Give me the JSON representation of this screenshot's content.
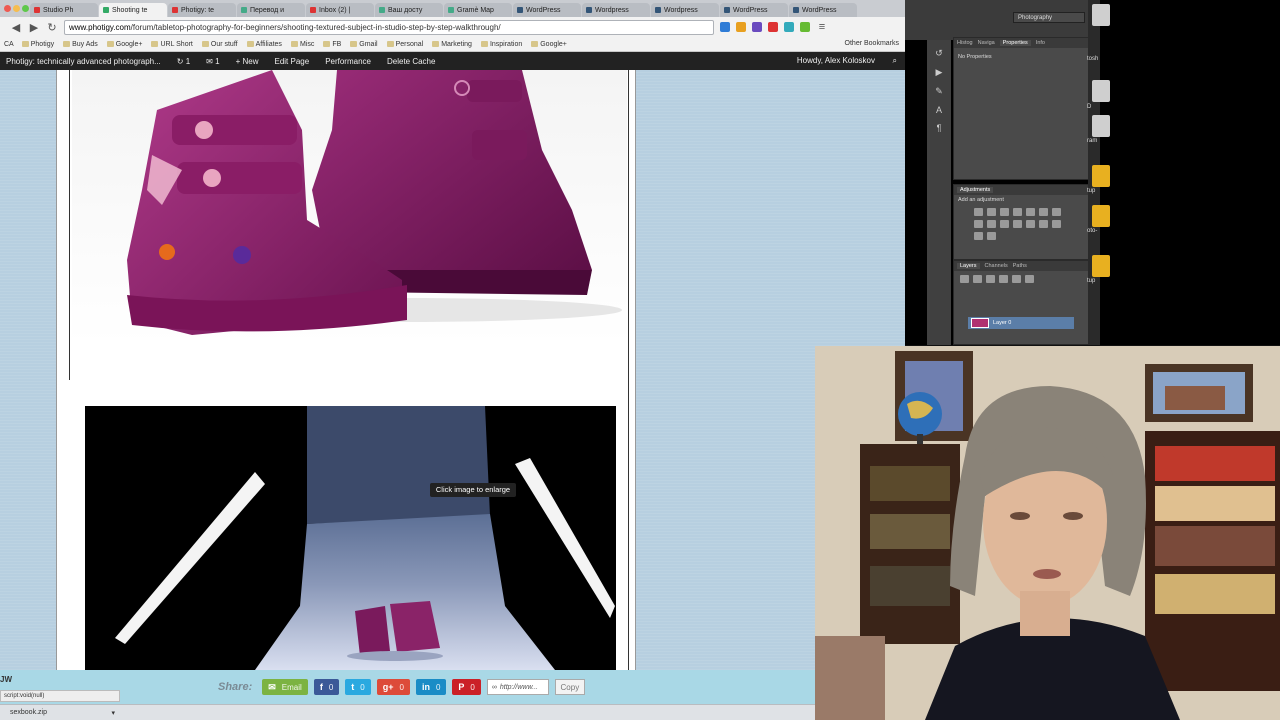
{
  "browser": {
    "tabs": [
      {
        "label": "Studio Ph",
        "color": "#d33"
      },
      {
        "label": "Shooting te",
        "color": "#3a6",
        "active": true
      },
      {
        "label": "Photigy: te",
        "color": "#d33"
      },
      {
        "label": "Перевод и",
        "color": "#4a8"
      },
      {
        "label": "Inbox (2) |",
        "color": "#d33"
      },
      {
        "label": "Ваш досту",
        "color": "#4a8"
      },
      {
        "label": "Gramè Map",
        "color": "#4a8"
      },
      {
        "label": "WordPress",
        "color": "#357"
      },
      {
        "label": "Wordpress",
        "color": "#357"
      },
      {
        "label": "Wordpress",
        "color": "#357"
      },
      {
        "label": "WordPress",
        "color": "#357"
      },
      {
        "label": "WordPress",
        "color": "#357"
      }
    ],
    "url_domain": "www.photigy.com",
    "url_path": "/forum/tabletop-photography-for-beginners/shooting-textured-subject-in-studio-step-by-step-walkthrough/",
    "bookmarks": [
      "Photigy",
      "Buy Ads",
      "Google+",
      "URL Short",
      "Our stuff",
      "Affiliates",
      "Misc",
      "FB",
      "Gmail",
      "Personal",
      "Marketing",
      "Inspiration",
      "Google+"
    ],
    "bookmarks_left_stub": "CA",
    "other_bookmarks": "Other Bookmarks"
  },
  "wp_admin": {
    "site": "Photigy: technically advanced photograph...",
    "updates": "1",
    "comments": "1",
    "new_label": "New",
    "edit_page": "Edit Page",
    "performance": "Performance",
    "delete_cache": "Delete Cache",
    "howdy": "Howdy, Alex Koloskov"
  },
  "page": {
    "tooltip": "Click image to enlarge"
  },
  "share": {
    "label": "Share:",
    "buttons": [
      {
        "name": "email",
        "icon": "✉",
        "text": "Email",
        "color": "#7cb342"
      },
      {
        "name": "facebook",
        "icon": "f",
        "text": "0",
        "color": "#3b5998"
      },
      {
        "name": "twitter",
        "icon": "t",
        "text": "0",
        "color": "#2aa9e0"
      },
      {
        "name": "googleplus",
        "icon": "g+",
        "text": "0",
        "color": "#dd4b39"
      },
      {
        "name": "linkedin",
        "icon": "in",
        "text": "0",
        "color": "#1a8cc6"
      },
      {
        "name": "pinterest",
        "icon": "P",
        "text": "0",
        "color": "#cb2027"
      }
    ],
    "link": "http://www...",
    "copy": "Copy"
  },
  "status": {
    "left_stub": "JW",
    "script": "script:void(null)",
    "download_file": "sexbook.zip"
  },
  "photoshop": {
    "workspace": "Photography",
    "top_tabs": [
      "Histog",
      "Naviga",
      "Properties",
      "Info"
    ],
    "properties_text": "No Properties",
    "adjustments_tab": "Adjustments",
    "adjustments_text": "Add an adjustment",
    "layer_tabs": [
      "Layers",
      "Channels",
      "Paths"
    ],
    "layer_name": "Layer 0"
  },
  "desktop_labels": [
    "tosh",
    "D",
    "ram",
    "tup",
    "oto-",
    "tup"
  ]
}
